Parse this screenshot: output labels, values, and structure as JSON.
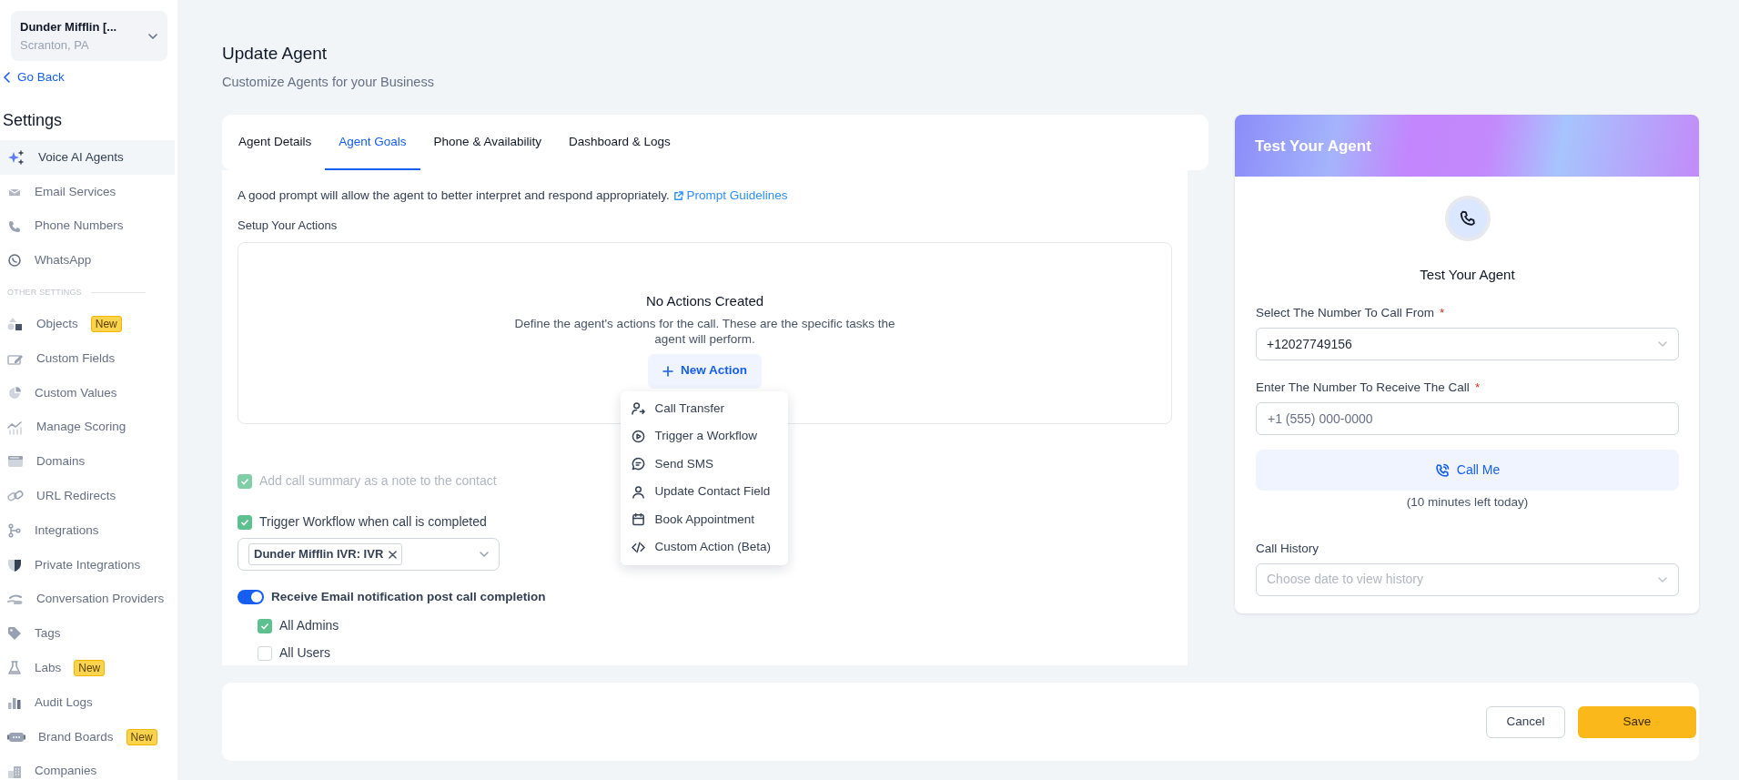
{
  "org": {
    "name": "Dunder Mifflin [...",
    "location": "Scranton, PA"
  },
  "back_link": "Go Back",
  "sidebar": {
    "title": "Settings",
    "items": [
      {
        "label": "Voice AI Agents",
        "selected": true
      },
      {
        "label": "Email Services",
        "selected": false
      },
      {
        "label": "Phone Numbers",
        "selected": false
      },
      {
        "label": "WhatsApp",
        "selected": false
      }
    ],
    "section_label": "OTHER SETTINGS",
    "other_items": [
      {
        "label": "Objects",
        "badge": "New",
        "selected": false
      },
      {
        "label": "Custom Fields",
        "selected": false
      },
      {
        "label": "Custom Values",
        "selected": false
      },
      {
        "label": "Manage Scoring",
        "selected": false
      },
      {
        "label": "Domains",
        "selected": false
      },
      {
        "label": "URL Redirects",
        "selected": false
      },
      {
        "label": "Integrations",
        "selected": false
      },
      {
        "label": "Private Integrations",
        "selected": false
      },
      {
        "label": "Conversation Providers",
        "selected": false
      },
      {
        "label": "Tags",
        "selected": false
      },
      {
        "label": "Labs",
        "badge": "New",
        "selected": false
      },
      {
        "label": "Audit Logs",
        "selected": false
      },
      {
        "label": "Brand Boards",
        "badge": "New",
        "selected": false
      },
      {
        "label": "Companies",
        "selected": false
      }
    ]
  },
  "page": {
    "title": "Update Agent",
    "subtitle": "Customize Agents for your Business"
  },
  "tabs": [
    {
      "label": "Agent Details",
      "selected": false
    },
    {
      "label": "Agent Goals",
      "selected": true
    },
    {
      "label": "Phone & Availability",
      "selected": false
    },
    {
      "label": "Dashboard & Logs",
      "selected": false
    }
  ],
  "content": {
    "hint": "A good prompt will allow the agent to better interpret and respond appropriately.",
    "guidelines_link": "Prompt Guidelines",
    "actions_label": "Setup Your Actions",
    "empty_title": "No Actions Created",
    "empty_text": "Define the agent's actions for the call. These are the specific tasks the agent will perform.",
    "new_action": "New Action",
    "menu": [
      {
        "label": "Call Transfer"
      },
      {
        "label": "Trigger a Workflow"
      },
      {
        "label": "Send SMS"
      },
      {
        "label": "Update Contact Field"
      },
      {
        "label": "Book Appointment"
      },
      {
        "label": "Custom Action (Beta)"
      }
    ],
    "summary_option": {
      "label": "Add call summary as a note to the contact",
      "checked": true,
      "disabled": true
    },
    "workflow_option": {
      "label": "Trigger Workflow when call is completed",
      "checked": true,
      "disabled": false
    },
    "workflow_tags": [
      "Dunder Mifflin IVR: IVR"
    ],
    "email_toggle": {
      "label": "Receive Email notification post call completion",
      "on": true
    },
    "recipients": [
      {
        "label": "All Admins",
        "checked": true
      },
      {
        "label": "All Users",
        "checked": false
      }
    ]
  },
  "test_panel": {
    "header": "Test Your Agent",
    "title": "Test Your Agent",
    "from_label": "Select The Number To Call From",
    "from_required": "*",
    "from_value": "+12027749156",
    "to_label": "Enter The Number To Receive The Call",
    "to_required": "*",
    "to_placeholder": "+1 (555) 000-0000",
    "call_button": "Call Me",
    "minutes_left": "(10 minutes left today)",
    "history_label": "Call History",
    "history_placeholder": "Choose date to view history"
  },
  "footer": {
    "cancel": "Cancel",
    "save": "Save"
  }
}
